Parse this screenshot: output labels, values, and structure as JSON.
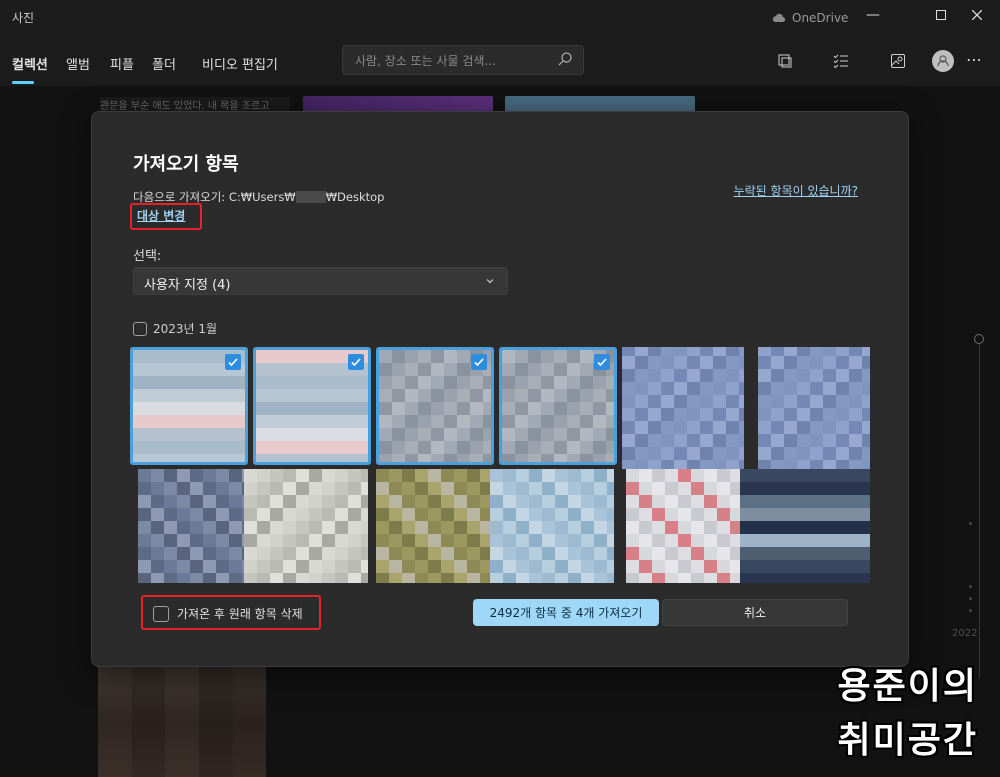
{
  "app": {
    "title": "사진",
    "onedrive_label": "OneDrive",
    "nav_tabs": [
      "컬렉션",
      "앨범",
      "피플",
      "폴더",
      "비디오 편집기"
    ],
    "active_tab": "컬렉션",
    "search_placeholder": "사람, 장소 또는 사물 검색..."
  },
  "background": {
    "caption_snippet": "관문을 부순 애도 있었다. 내 목을 조르고",
    "timeline_year": "2022"
  },
  "dialog": {
    "title": "가져오기 항목",
    "destination_prefix": "다음으로 가져오기:",
    "destination_path_start": "C:₩Users₩",
    "destination_path_end": "₩Desktop",
    "change_destination_link": "대상 변경",
    "missing_items_link": "누락된 항목이 있습니까?",
    "select_label": "선택:",
    "select_value": "사용자 지정 (4)",
    "group_label": "2023년 1월",
    "delete_after_import_label": "가져온 후 원래 항목 삭제",
    "import_button": "2492개 항목 중 4개 가져오기",
    "cancel_button": "취소",
    "thumbnails": [
      {
        "selected": true,
        "palette": "light-blue-pink"
      },
      {
        "selected": true,
        "palette": "light-blue-pink"
      },
      {
        "selected": true,
        "palette": "grey-blue"
      },
      {
        "selected": true,
        "palette": "grey-blue"
      },
      {
        "selected": false,
        "palette": "blue"
      },
      {
        "selected": false,
        "palette": "blue"
      },
      {
        "selected": false,
        "palette": "blue-grey"
      },
      {
        "selected": false,
        "palette": "white-grey"
      },
      {
        "selected": false,
        "palette": "olive"
      },
      {
        "selected": false,
        "palette": "light-blue"
      },
      {
        "selected": false,
        "palette": "white-red"
      },
      {
        "selected": false,
        "palette": "dark-multi"
      }
    ]
  },
  "watermark": {
    "line1": "용준이의",
    "line2": "취미공간"
  },
  "colors": {
    "accent": "#60cdff",
    "selection_border": "#4aa0dc",
    "primary_button": "#9fd7f9",
    "highlight_box": "#e8212b"
  }
}
